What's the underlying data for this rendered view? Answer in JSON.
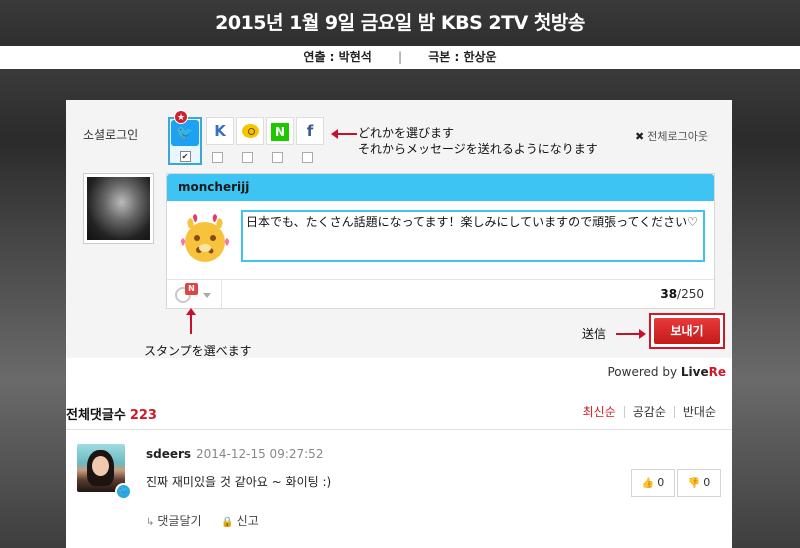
{
  "banner": {
    "title": "2015년 1월 9일 금요일 밤   KBS 2TV 첫방송"
  },
  "credits": {
    "director": "연출 : 박현석",
    "separator": "|",
    "writer": "극본 : 한상운"
  },
  "compose": {
    "social_login_label": "소셜로그인",
    "sns": [
      "twitter",
      "kakao",
      "kakaostory",
      "naver",
      "facebook"
    ],
    "sns_glyphs": {
      "kakao": "K",
      "naver": "N",
      "facebook": "f",
      "twitter": "🐦"
    },
    "badge_star": "★",
    "checked_mark": "✔",
    "logout_all": "전체로그아웃",
    "logout_x": "✖",
    "annotation_sns": "どれかを選びます\nそれからメッセージを送れるようになります",
    "username": "moncherijj",
    "message": "日本でも、たくさん話題になってます！楽しみにしていますので頑張ってください♡",
    "counter_current": "38",
    "counter_max": "/250",
    "stamp_badge": "N",
    "annotation_stamp": "スタンプを選べます",
    "annotation_send": "送信",
    "send_label": "보내기"
  },
  "powered": {
    "prefix": "Powered by ",
    "live": "Live",
    "re": "Re"
  },
  "comments_header": {
    "label": "전체댓글수",
    "count": "223",
    "sort_options": [
      "최신순",
      "공감순",
      "반대순"
    ]
  },
  "comments": [
    {
      "user": "sdeers",
      "date": "2014-12-15 09:27:52",
      "text": "진짜 재미있을 것 같아요 ~ 화이팅 :)",
      "likes": "0",
      "dislikes": "0",
      "reply_label": "댓글달기",
      "report_label": "신고"
    }
  ],
  "colors": {
    "accent_blue": "#3ec4f3",
    "accent_red": "#d01828",
    "twitter": "#1da1f2",
    "naver": "#1ec800"
  }
}
